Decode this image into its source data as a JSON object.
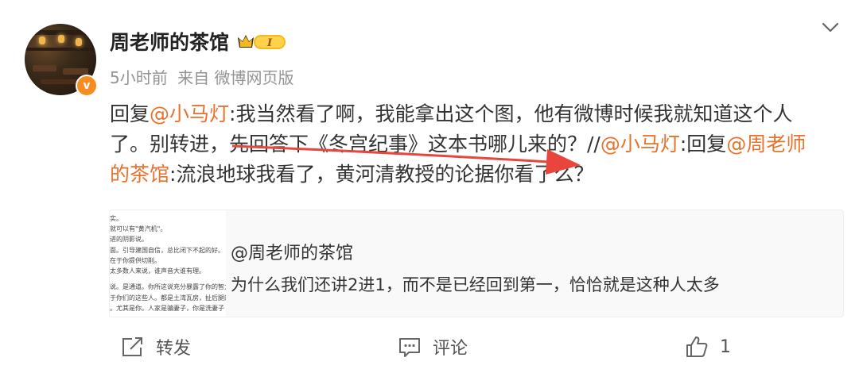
{
  "post": {
    "username": "周老师的茶馆",
    "vip_level": "I",
    "time": "5小时前",
    "source": "来自 微博网页版",
    "verified_mark": "v",
    "text": {
      "reply_prefix_1": "回复",
      "mention_1": "@小马灯",
      "text_1": ":我当然看了啊，我能拿出这个图，他有微博时候我就知道这个人了。别转进，先回答下《冬宫纪事》这本书哪儿来的？//",
      "mention_2": "@小马灯",
      "text_2": ":回复",
      "mention_3": "@周老师的茶馆",
      "text_3": ":流浪地球我看了，黄河清教授的论据你看了么？"
    },
    "quote": {
      "author": "@周老师的茶馆",
      "text": "为什么我们还讲2进1，而不是已经回到第一，恰恰就是这种人太多",
      "thumb_lines": [
        "实。",
        "就可以有\"黄汽机\"。",
        "进的阴影说。",
        "面。引导建国自信，总比闭下不起的好。",
        "在于你提供切削。",
        "太多数人来说，谁声音大谁有理。",
        "说。是通道。你所这说充分暴露了你的智力。",
        "于你们的这些人。都是土湾瓦房，扯后腿的",
        "。尤其是你。人家是骗妻子，你是洗妻子"
      ]
    },
    "actions": {
      "repost_label": "转发",
      "comment_label": "评论",
      "like_count": "1"
    },
    "colors": {
      "mention": "#e8712b",
      "verified": "#f78c22",
      "arrow": "#e8453c"
    }
  }
}
